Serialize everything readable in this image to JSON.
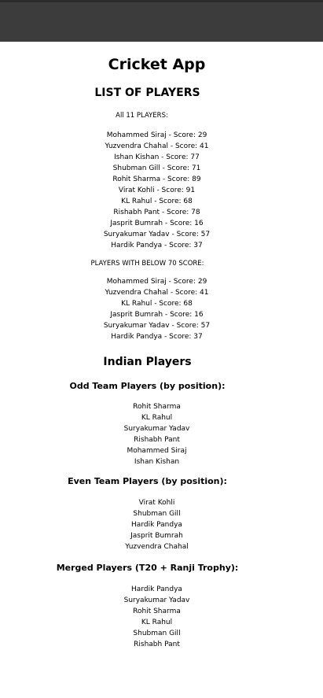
{
  "app": {
    "title": "Cricket App"
  },
  "list_section": {
    "heading": "LIST OF PLAYERS",
    "all_label": "All 11 PLAYERS:",
    "all_players": [
      "Mohammed Siraj - Score: 29",
      "Yuzvendra Chahal - Score: 41",
      "Ishan Kishan - Score: 77",
      "Shubman Gill - Score: 71",
      "Rohit Sharma - Score: 89",
      "Virat Kohli - Score: 91",
      "KL Rahul - Score: 68",
      "Rishabh Pant - Score: 78",
      "Jasprit Bumrah - Score: 16",
      "Suryakumar Yadav - Score: 57",
      "Hardik Pandya - Score: 37"
    ],
    "below_label": "PLAYERS WITH BELOW 70 SCORE:",
    "below_players": [
      "Mohammed Siraj - Score: 29",
      "Yuzvendra Chahal - Score: 41",
      "KL Rahul - Score: 68",
      "Jasprit Bumrah - Score: 16",
      "Suryakumar Yadav - Score: 57",
      "Hardik Pandya - Score: 37"
    ]
  },
  "indian_section": {
    "heading": "Indian Players",
    "odd_heading": "Odd Team Players (by position):",
    "odd_players": [
      "Rohit Sharma",
      "KL Rahul",
      "Suryakumar Yadav",
      "Rishabh Pant",
      "Mohammed Siraj",
      "Ishan Kishan"
    ],
    "even_heading": "Even Team Players (by position):",
    "even_players": [
      "Virat Kohli",
      "Shubman Gill",
      "Hardik Pandya",
      "Jasprit Bumrah",
      "Yuzvendra Chahal"
    ],
    "merged_heading": "Merged Players (T20 + Ranji Trophy):",
    "merged_players": [
      "Hardik Pandya",
      "Suryakumar Yadav",
      "Rohit Sharma",
      "KL Rahul",
      "Shubman Gill",
      "Rishabh Pant"
    ]
  }
}
